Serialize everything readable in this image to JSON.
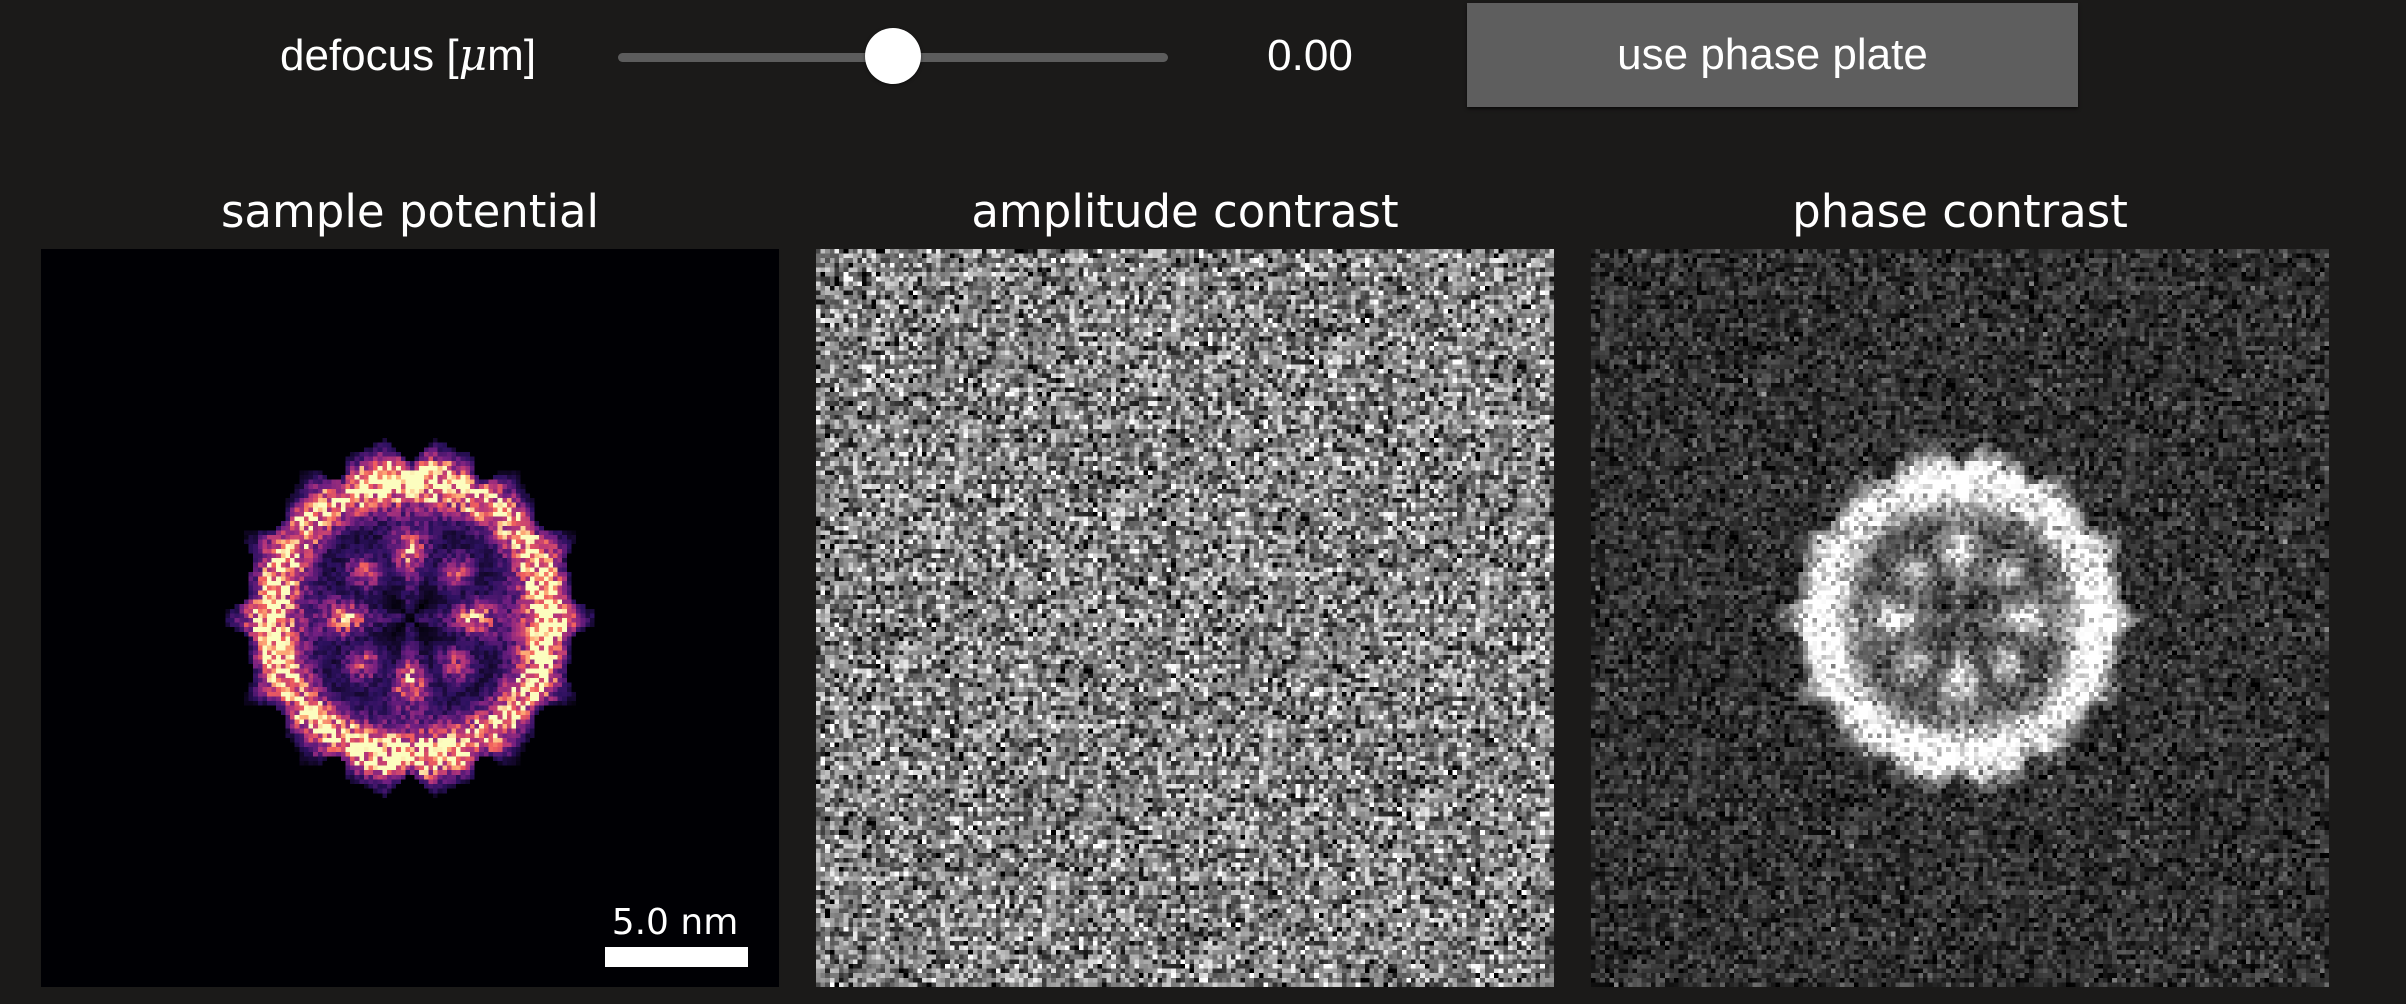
{
  "controls": {
    "defocus_label_prefix": "defocus [",
    "defocus_label_unit_mu": "μ",
    "defocus_label_suffix": "m]",
    "defocus_value": "0.00",
    "slider_fraction": 0.5,
    "phase_plate_button_label": "use phase plate"
  },
  "panels": [
    {
      "title": "sample potential",
      "colormap": "magma"
    },
    {
      "title": "amplitude contrast",
      "colormap": "gray"
    },
    {
      "title": "phase contrast",
      "colormap": "gray"
    }
  ],
  "scalebar": {
    "label": "5.0 nm"
  },
  "colors": {
    "background": "#1b1a19",
    "button": "#5e5e5e",
    "slider_track": "#5c5c5c",
    "text": "#ffffff"
  }
}
